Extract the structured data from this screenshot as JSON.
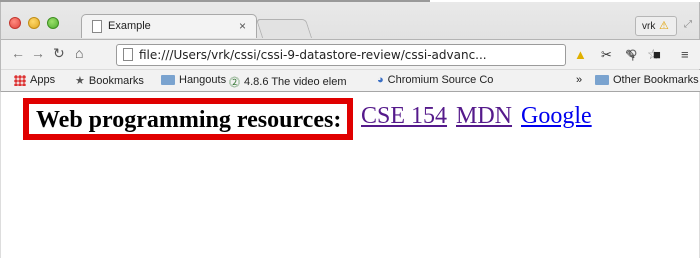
{
  "browser": {
    "tab": {
      "title": "Example",
      "close": "×"
    },
    "profile": {
      "name": "vrk"
    },
    "address_bar": {
      "url": "file:///Users/vrk/cssi/cssi-9-datastore-review/cssi-advanc..."
    },
    "icons": {
      "back": "back-arrow-icon",
      "forward": "forward-arrow-icon",
      "reload": "reload-icon",
      "home": "home-icon",
      "zoom": "zoom-icon",
      "star": "bookmark-star-icon",
      "menu": "hamburger-menu-icon"
    },
    "bookmarks": [
      {
        "label": "Apps",
        "icon": "apps-icon"
      },
      {
        "label": "Bookmarks",
        "icon": "star-icon"
      },
      {
        "label": "Hangouts",
        "icon": "folder-icon"
      },
      {
        "label": "4.8.6 The video elem",
        "icon": "w3c-icon"
      },
      {
        "label": "Chromium Source Co",
        "icon": "chromium-icon"
      },
      {
        "label": "»",
        "icon": ""
      },
      {
        "label": "Other Bookmarks",
        "icon": "folder-icon"
      }
    ]
  },
  "page": {
    "heading": "Web programming resources:",
    "links": [
      {
        "label": "CSE 154",
        "state": "visited"
      },
      {
        "label": "MDN",
        "state": "visited"
      },
      {
        "label": "Google",
        "state": "unvisited"
      }
    ],
    "colors": {
      "border": "#e00000",
      "visited": "#551a8b",
      "unvisited": "#0000ee"
    }
  }
}
